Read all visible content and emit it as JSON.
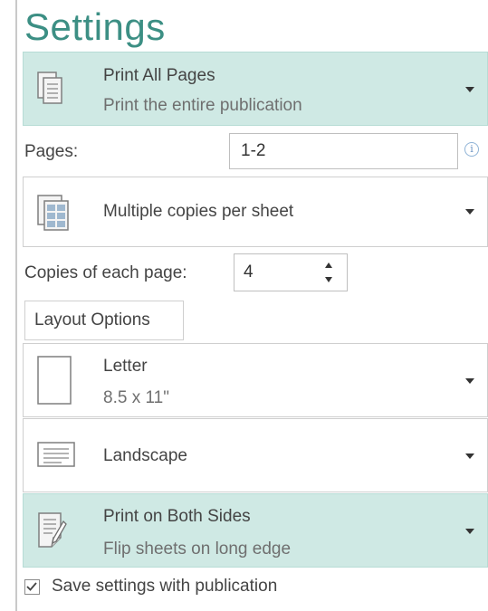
{
  "settings": {
    "title": "Settings",
    "print_range": {
      "label": "Print All Pages",
      "sub": "Print the entire publication",
      "icon": "pages-stack-icon"
    },
    "pages": {
      "label": "Pages:",
      "value": "1-2"
    },
    "copies_layout": {
      "label": "Multiple copies per sheet",
      "icon": "multiple-copies-icon"
    },
    "copies": {
      "label": "Copies of each page:",
      "value": "4"
    },
    "layout_options": {
      "label": "Layout Options"
    },
    "paper": {
      "label": "Letter",
      "sub": "8.5 x 11\"",
      "icon": "blank-page-icon"
    },
    "orientation": {
      "label": "Landscape",
      "icon": "landscape-page-icon"
    },
    "duplex": {
      "label": "Print on Both Sides",
      "sub": "Flip sheets on long edge",
      "icon": "duplex-page-icon"
    },
    "save_settings": {
      "label": "Save settings with publication",
      "checked": true
    }
  },
  "colors": {
    "accent": "#3c8f84",
    "highlight": "#cfe9e4",
    "border": "#cfcfcf"
  }
}
